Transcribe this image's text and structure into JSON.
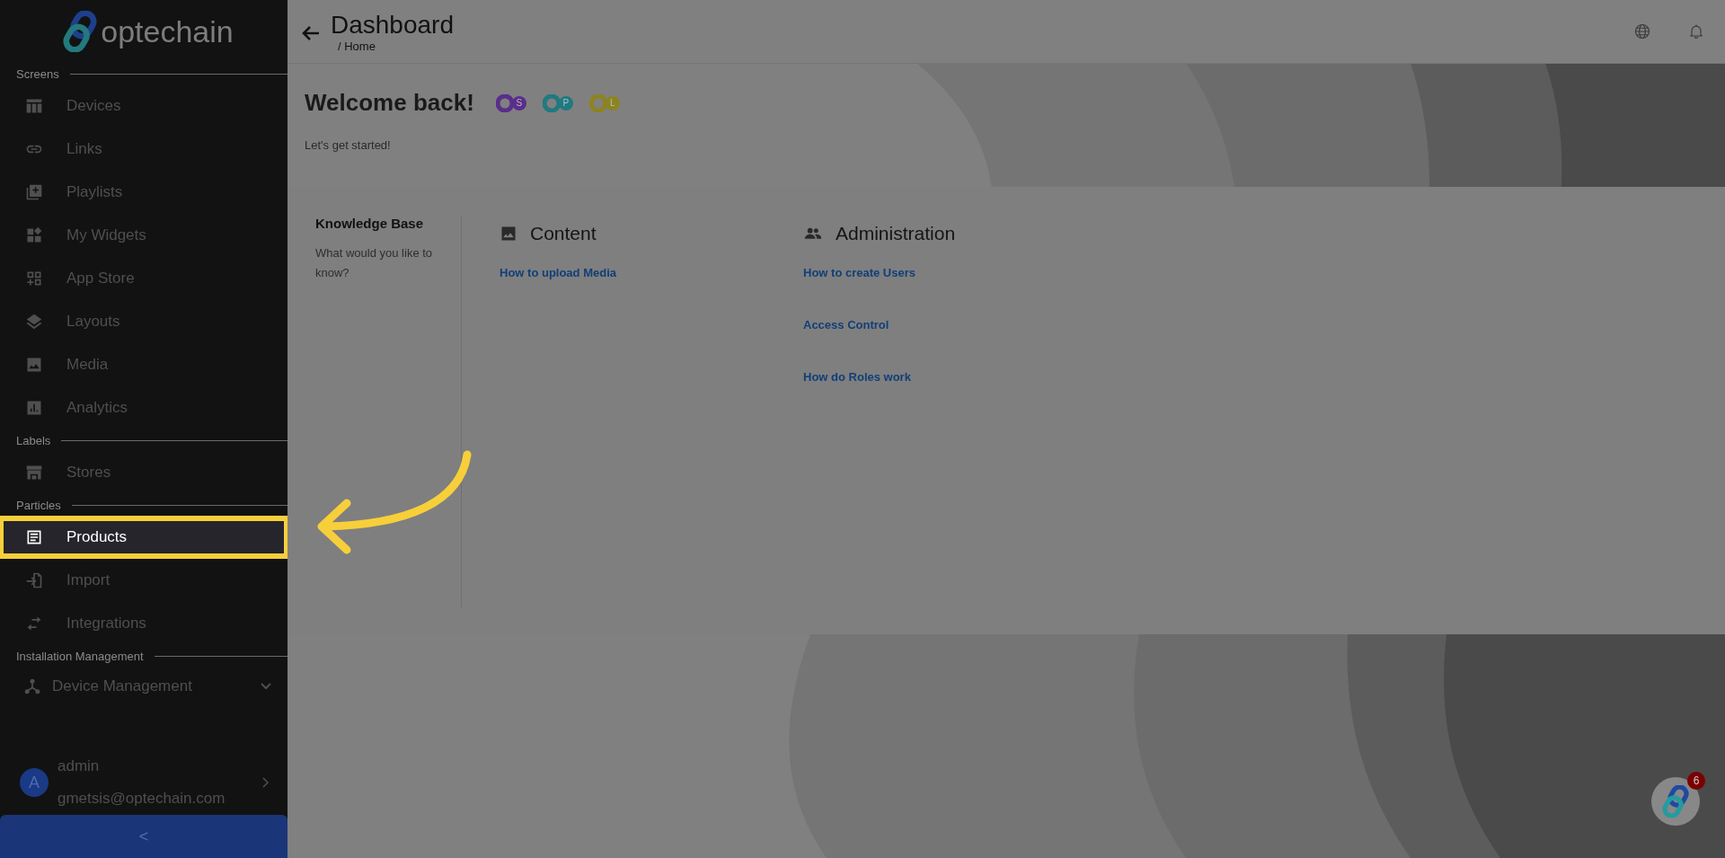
{
  "sidebar": {
    "logo": "optechain",
    "sections": [
      {
        "title": "Screens",
        "items": [
          {
            "label": "Devices",
            "selected": false,
            "highlighted": false,
            "kind": "link"
          },
          {
            "label": "Links",
            "selected": false,
            "highlighted": false,
            "kind": "link"
          },
          {
            "label": "Playlists",
            "selected": false,
            "highlighted": false,
            "kind": "link"
          },
          {
            "label": "My Widgets",
            "selected": false,
            "highlighted": false,
            "kind": "link"
          },
          {
            "label": "App Store",
            "selected": false,
            "highlighted": false,
            "kind": "link"
          },
          {
            "label": "Layouts",
            "selected": false,
            "highlighted": false,
            "kind": "link"
          },
          {
            "label": "Media",
            "selected": false,
            "highlighted": false,
            "kind": "link"
          },
          {
            "label": "Analytics",
            "selected": false,
            "highlighted": false,
            "kind": "link"
          }
        ]
      },
      {
        "title": "Labels",
        "items": [
          {
            "label": "Stores",
            "selected": false,
            "highlighted": false,
            "kind": "link"
          }
        ]
      },
      {
        "title": "Particles",
        "items": [
          {
            "label": "Products",
            "selected": true,
            "highlighted": true,
            "kind": "link"
          },
          {
            "label": "Import",
            "selected": false,
            "highlighted": false,
            "kind": "link"
          },
          {
            "label": "Integrations",
            "selected": false,
            "highlighted": false,
            "kind": "link"
          }
        ]
      },
      {
        "title": "Installation Management",
        "items": [
          {
            "label": "Device Management",
            "kind": "group",
            "expanded": false
          }
        ]
      }
    ],
    "user": {
      "initial": "A",
      "name": "admin",
      "email": "gmetsis@optechain.com"
    },
    "collapse_button": "<"
  },
  "header": {
    "title": "Dashboard",
    "breadcrumb": "/ Home"
  },
  "welcome": {
    "heading": "Welcome back!",
    "subtitle": "Let's get started!",
    "apps": [
      {
        "letter": "S",
        "color": "#5a2e8c"
      },
      {
        "letter": "P",
        "color": "#1f7a80"
      },
      {
        "letter": "L",
        "color": "#8c8420"
      }
    ]
  },
  "knowledge": {
    "title": "Knowledge Base",
    "text": "What would you like to know?",
    "columns": [
      {
        "title": "Content",
        "links": [
          "How to upload Media"
        ]
      },
      {
        "title": "Administration",
        "links": [
          "How to create Users",
          "Access Control",
          "How do Roles work"
        ]
      }
    ]
  },
  "chat": {
    "badge": "6"
  }
}
